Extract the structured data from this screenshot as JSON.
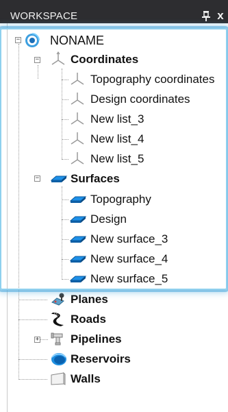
{
  "panel": {
    "title": "WORKSPACE",
    "pin_icon": "pin-icon",
    "close_label": "x"
  },
  "tree": {
    "root": {
      "label": "NONAME",
      "icon": "project-icon",
      "expanded": true
    },
    "coordinates": {
      "label": "Coordinates",
      "icon": "coordinates-axes-icon",
      "expanded": true,
      "children": [
        {
          "label": "Topography coordinates"
        },
        {
          "label": "Design coordinates"
        },
        {
          "label": "New list_3"
        },
        {
          "label": "New list_4"
        },
        {
          "label": "New list_5"
        }
      ]
    },
    "surfaces": {
      "label": "Surfaces",
      "icon": "surface-icon",
      "expanded": true,
      "children": [
        {
          "label": "Topography"
        },
        {
          "label": "Design"
        },
        {
          "label": "New surface_3"
        },
        {
          "label": "New surface_4"
        },
        {
          "label": "New surface_5"
        }
      ]
    },
    "planes": {
      "label": "Planes",
      "icon": "planes-icon"
    },
    "roads": {
      "label": "Roads",
      "icon": "road-icon"
    },
    "pipelines": {
      "label": "Pipelines",
      "icon": "pipeline-icon",
      "expanded": false
    },
    "reservoirs": {
      "label": "Reservoirs",
      "icon": "reservoir-icon"
    },
    "walls": {
      "label": "Walls",
      "icon": "wall-icon"
    }
  },
  "colors": {
    "titlebar": "#2d2d30",
    "selection_glow": "#50aadc"
  }
}
